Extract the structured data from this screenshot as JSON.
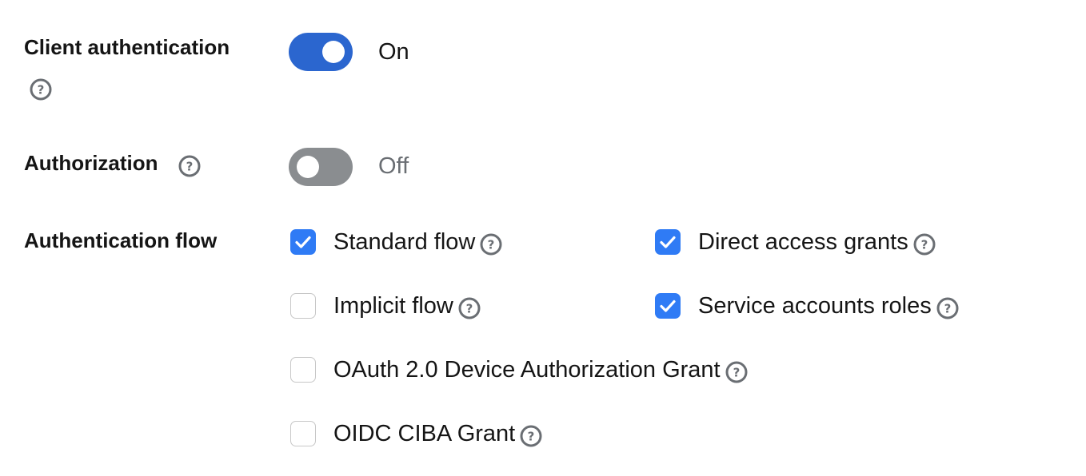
{
  "client_authentication": {
    "label": "Client authentication",
    "state_text": "On",
    "enabled": true
  },
  "authorization": {
    "label": "Authorization",
    "state_text": "Off",
    "enabled": false
  },
  "authentication_flow": {
    "label": "Authentication flow",
    "options": [
      {
        "label": "Standard flow",
        "checked": true
      },
      {
        "label": "Direct access grants",
        "checked": true
      },
      {
        "label": "Implicit flow",
        "checked": false
      },
      {
        "label": "Service accounts roles",
        "checked": true
      },
      {
        "label": "OAuth 2.0 Device Authorization Grant",
        "checked": false
      },
      {
        "label": "OIDC CIBA Grant",
        "checked": false
      }
    ]
  },
  "colors": {
    "switch_on": "#2b66cf",
    "switch_off": "#8a8d90",
    "checkbox_checked": "#2f7bf5",
    "help_icon": "#6a6e73"
  },
  "icons": {
    "help": "question-circle-icon",
    "check": "checkmark-icon"
  }
}
